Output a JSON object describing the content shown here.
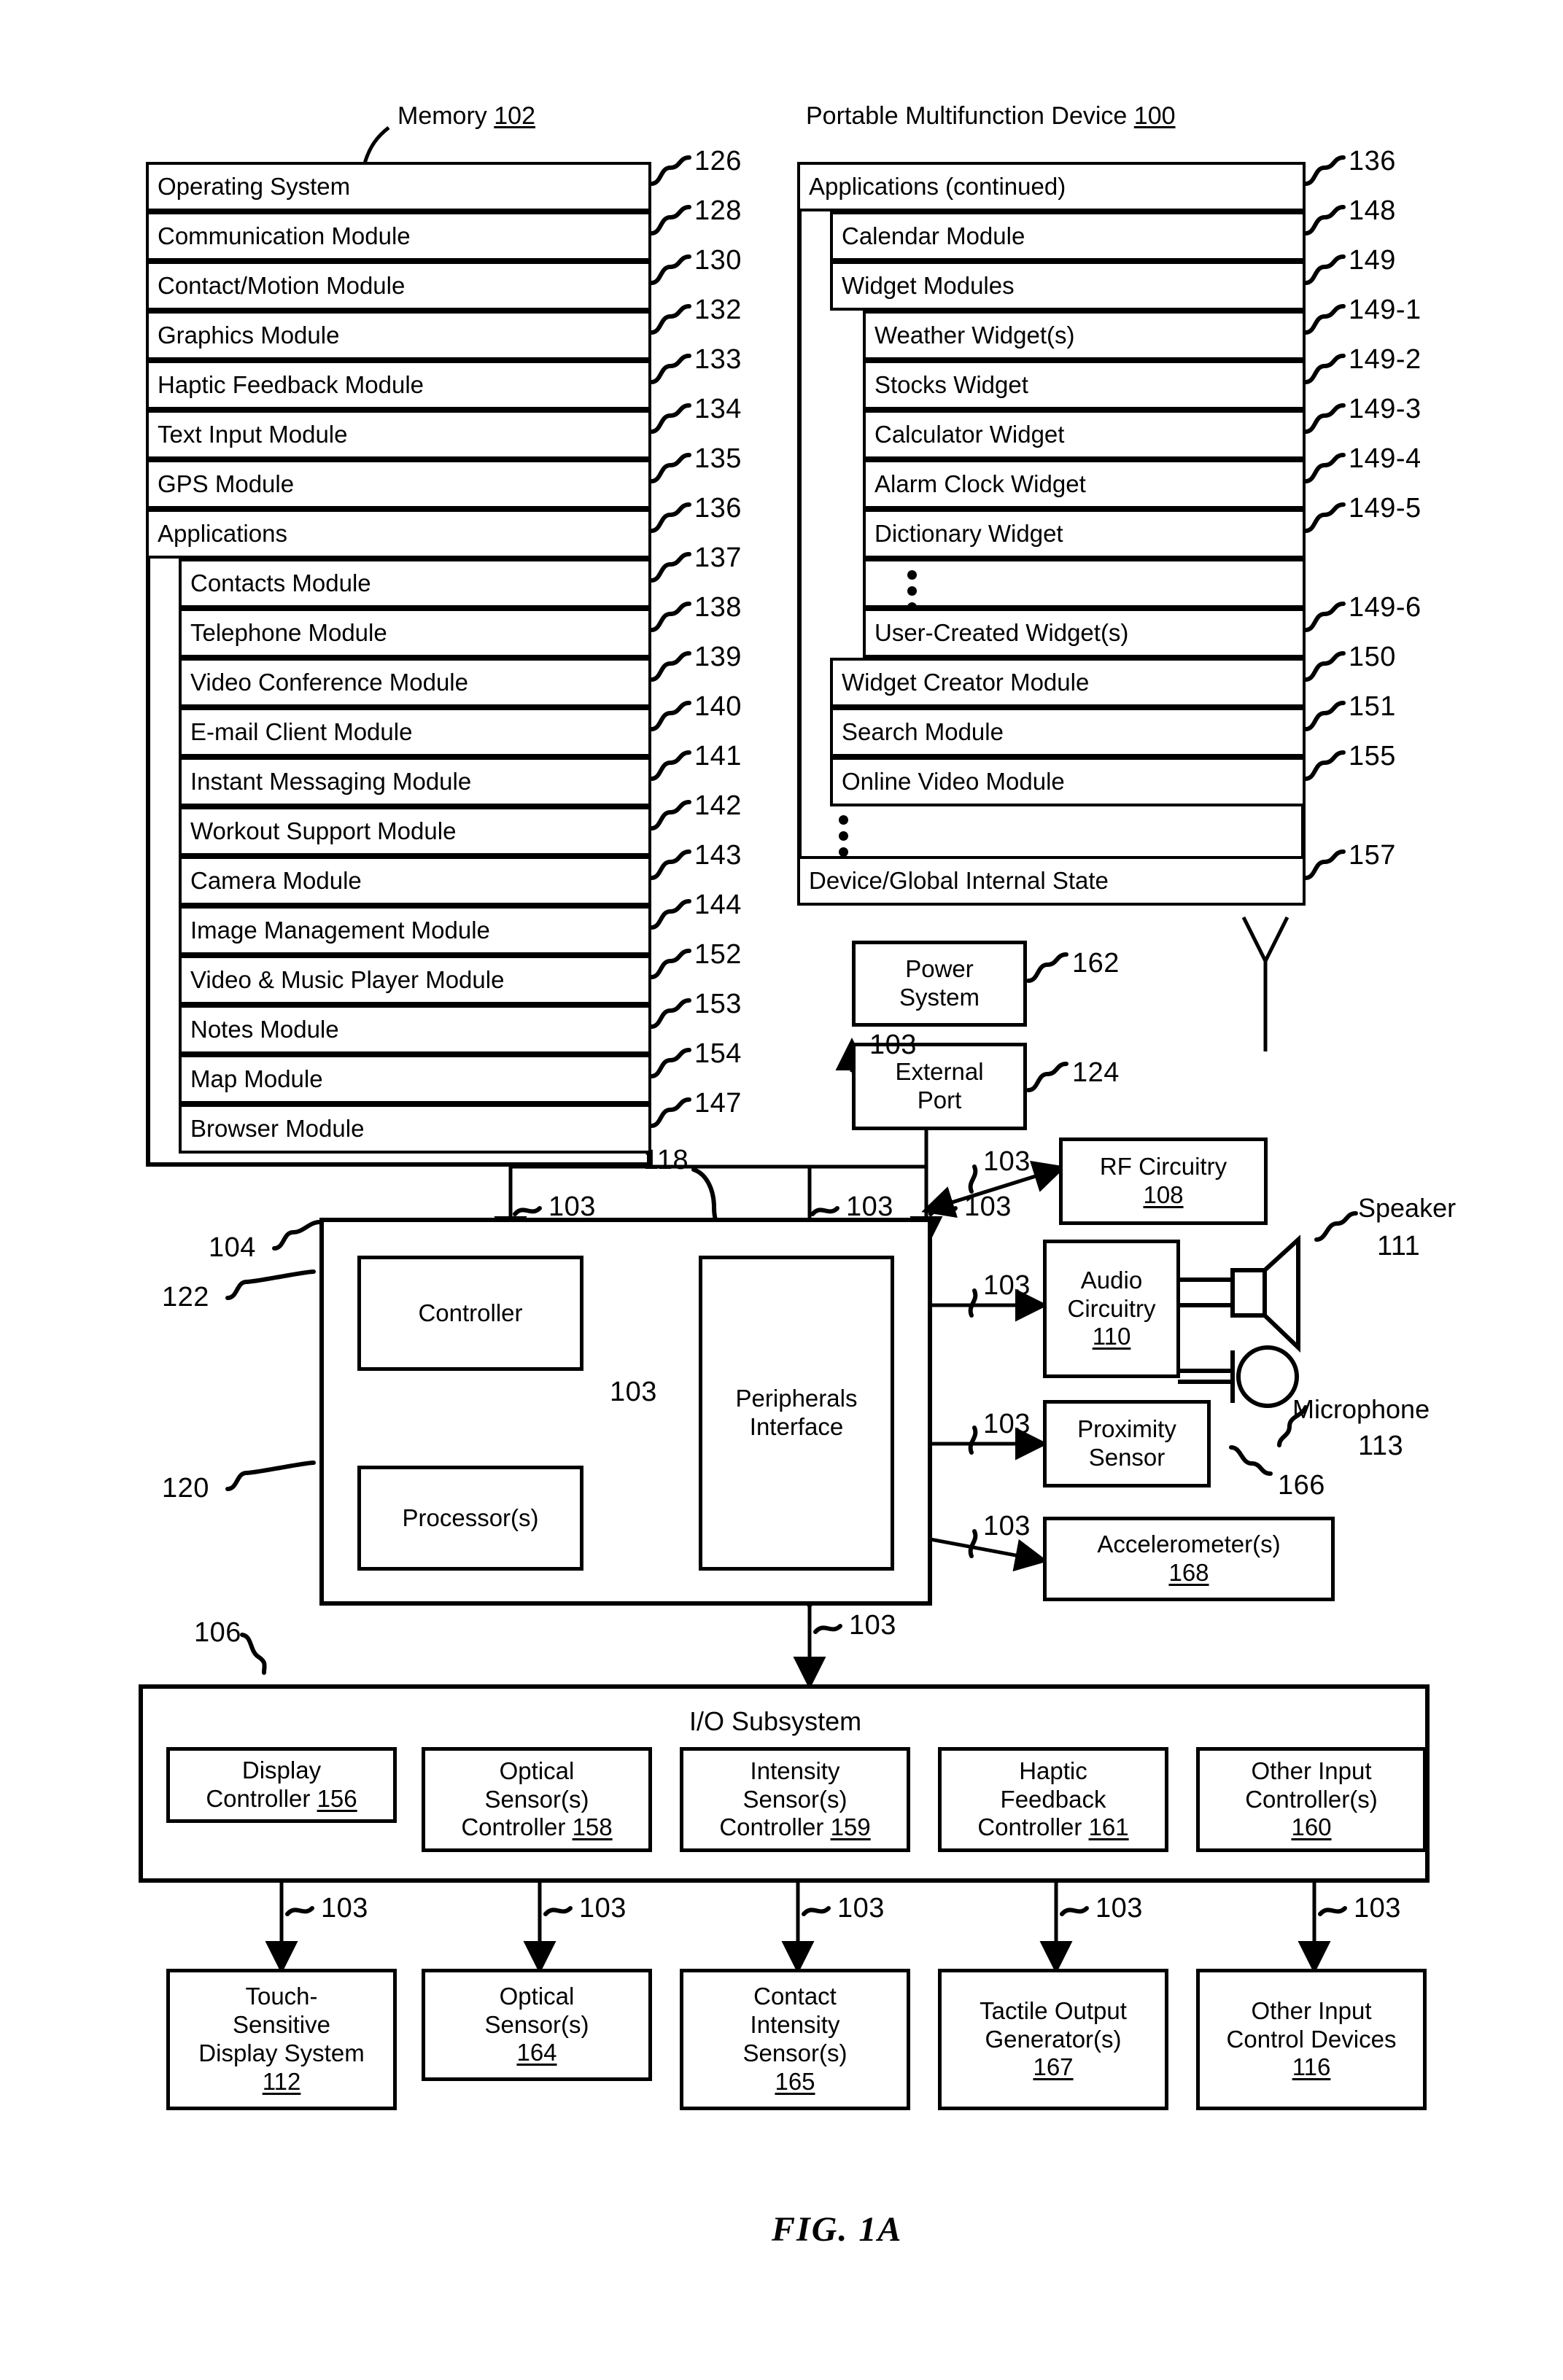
{
  "figure": {
    "label": "FIG. 1A"
  },
  "memory": {
    "title": "Memory",
    "title_number": "102",
    "items": [
      {
        "label": "Operating System",
        "ref": "126",
        "indent": 0
      },
      {
        "label": "Communication Module",
        "ref": "128",
        "indent": 0
      },
      {
        "label": "Contact/Motion Module",
        "ref": "130",
        "indent": 0
      },
      {
        "label": "Graphics Module",
        "ref": "132",
        "indent": 0
      },
      {
        "label": "Haptic Feedback Module",
        "ref": "133",
        "indent": 0
      },
      {
        "label": "Text Input Module",
        "ref": "134",
        "indent": 0
      },
      {
        "label": "GPS Module",
        "ref": "135",
        "indent": 0
      },
      {
        "label": "Applications",
        "ref": "136",
        "indent": 0
      },
      {
        "label": "Contacts Module",
        "ref": "137",
        "indent": 1
      },
      {
        "label": "Telephone Module",
        "ref": "138",
        "indent": 1
      },
      {
        "label": "Video Conference Module",
        "ref": "139",
        "indent": 1
      },
      {
        "label": "E-mail Client Module",
        "ref": "140",
        "indent": 1
      },
      {
        "label": "Instant Messaging Module",
        "ref": "141",
        "indent": 1
      },
      {
        "label": "Workout Support Module",
        "ref": "142",
        "indent": 1
      },
      {
        "label": "Camera Module",
        "ref": "143",
        "indent": 1
      },
      {
        "label": "Image Management Module",
        "ref": "144",
        "indent": 1
      },
      {
        "label": "Video & Music Player Module",
        "ref": "152",
        "indent": 1
      },
      {
        "label": "Notes Module",
        "ref": "153",
        "indent": 1
      },
      {
        "label": "Map Module",
        "ref": "154",
        "indent": 1
      },
      {
        "label": "Browser Module",
        "ref": "147",
        "indent": 1
      }
    ]
  },
  "device": {
    "title": "Portable Multifunction Device",
    "title_number": "100",
    "items": [
      {
        "label": "Applications (continued)",
        "ref": "136",
        "indent": 0
      },
      {
        "label": "Calendar Module",
        "ref": "148",
        "indent": 1
      },
      {
        "label": "Widget Modules",
        "ref": "149",
        "indent": 1
      },
      {
        "label": "Weather Widget(s)",
        "ref": "149-1",
        "indent": 2
      },
      {
        "label": "Stocks Widget",
        "ref": "149-2",
        "indent": 2
      },
      {
        "label": "Calculator Widget",
        "ref": "149-3",
        "indent": 2
      },
      {
        "label": "Alarm Clock Widget",
        "ref": "149-4",
        "indent": 2
      },
      {
        "label": "Dictionary Widget",
        "ref": "149-5",
        "indent": 2
      },
      {
        "label": "",
        "ref": "",
        "indent": 2,
        "dots": true
      },
      {
        "label": "User-Created Widget(s)",
        "ref": "149-6",
        "indent": 2
      },
      {
        "label": "Widget Creator Module",
        "ref": "150",
        "indent": 1
      },
      {
        "label": "Search Module",
        "ref": "151",
        "indent": 1
      },
      {
        "label": "Online Video Module",
        "ref": "155",
        "indent": 1
      },
      {
        "label": "",
        "ref": "",
        "indent": 1,
        "dots": true
      },
      {
        "label": "Device/Global Internal State",
        "ref": "157",
        "indent": 0
      }
    ]
  },
  "power": {
    "line1": "Power",
    "line2": "System",
    "ref": "162"
  },
  "external_port": {
    "line1": "External",
    "line2": "Port",
    "ref": "124"
  },
  "cpu_block": {
    "ref_outer": "104",
    "ref_controller": "122",
    "ref_processor": "120",
    "ref_peripherals": "118",
    "controller_label": "Controller",
    "processor_label": "Processor(s)",
    "peripherals_line1": "Peripherals",
    "peripherals_line2": "Interface"
  },
  "rf": {
    "line1": "RF Circuitry",
    "number": "108"
  },
  "audio": {
    "line1": "Audio",
    "line2": "Circuitry",
    "number": "110"
  },
  "speaker": {
    "label": "Speaker",
    "ref": "111"
  },
  "microphone": {
    "label": "Microphone",
    "ref": "113"
  },
  "proximity": {
    "line1": "Proximity",
    "line2": "Sensor",
    "ref": "166"
  },
  "accelerometer": {
    "line1": "Accelerometer(s)",
    "number": "168"
  },
  "io_subsystem": {
    "title": "I/O Subsystem",
    "ref": "106",
    "controllers": [
      {
        "line1": "Display",
        "line2": "Controller",
        "number": "156"
      },
      {
        "line1": "Optical",
        "line2": "Sensor(s)",
        "line3": "Controller",
        "number": "158"
      },
      {
        "line1": "Intensity",
        "line2": "Sensor(s)",
        "line3": "Controller",
        "number": "159"
      },
      {
        "line1": "Haptic",
        "line2": "Feedback",
        "line3": "Controller",
        "number": "161"
      },
      {
        "line1": "Other Input",
        "line2": "Controller(s)",
        "number": "160"
      }
    ],
    "devices": [
      {
        "line1": "Touch-",
        "line2": "Sensitive",
        "line3": "Display System",
        "number": "112"
      },
      {
        "line1": "Optical",
        "line2": "Sensor(s)",
        "number": "164"
      },
      {
        "line1": "Contact",
        "line2": "Intensity",
        "line3": "Sensor(s)",
        "number": "165"
      },
      {
        "line1": "Tactile Output",
        "line2": "Generator(s)",
        "number": "167"
      },
      {
        "line1": "Other Input",
        "line2": "Control Devices",
        "number": "116"
      }
    ]
  },
  "bus_ref": "103",
  "bus_refs": {
    "memory_to_cpu": "103",
    "controller_in": "103",
    "peripherals_in": "103",
    "internal_bus": "103",
    "rf_link": "103",
    "audio_link": "103",
    "proximity_link": "103",
    "accelerometer_link": "103",
    "io_link": "103",
    "external_port_link": "103"
  },
  "colors": {
    "line": "#000000",
    "background": "#ffffff"
  }
}
